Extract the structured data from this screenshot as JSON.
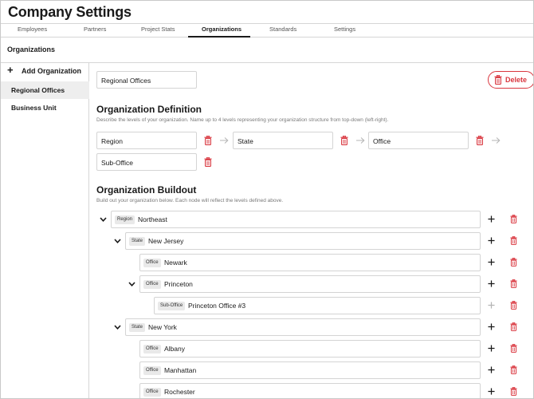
{
  "app": {
    "title": "Company Settings"
  },
  "tabs": [
    {
      "label": "Employees",
      "active": false
    },
    {
      "label": "Partners",
      "active": false
    },
    {
      "label": "Project Stats",
      "active": false
    },
    {
      "label": "Organizations",
      "active": true
    },
    {
      "label": "Standards",
      "active": false
    },
    {
      "label": "Settings",
      "active": false
    }
  ],
  "section": {
    "title": "Organizations"
  },
  "sidebar": {
    "add_label": "Add Organization",
    "items": [
      {
        "label": "Regional Offices",
        "selected": true
      },
      {
        "label": "Business Unit",
        "selected": false
      }
    ]
  },
  "org": {
    "name_value": "Regional Offices",
    "delete_label": "Delete"
  },
  "definition": {
    "title": "Organization Definition",
    "description": "Describe the levels of your organization. Name up to 4 levels representing your organization structure from top-down (left-right).",
    "levels": [
      "Region",
      "State",
      "Office",
      "Sub-Office"
    ]
  },
  "buildout": {
    "title": "Organization Buildout",
    "description": "Build out your organization below. Each node will reflect the levels defined above.",
    "nodes": [
      {
        "level": "Region",
        "name": "Northeast",
        "depth": 0,
        "expanded": true,
        "can_add": true
      },
      {
        "level": "State",
        "name": "New Jersey",
        "depth": 1,
        "expanded": true,
        "can_add": true
      },
      {
        "level": "Office",
        "name": "Newark",
        "depth": 2,
        "expanded": null,
        "can_add": true
      },
      {
        "level": "Office",
        "name": "Princeton",
        "depth": 2,
        "expanded": true,
        "can_add": true
      },
      {
        "level": "Sub-Office",
        "name": "Princeton Office #3",
        "depth": 3,
        "expanded": null,
        "can_add": false
      },
      {
        "level": "State",
        "name": "New York",
        "depth": 1,
        "expanded": true,
        "can_add": true
      },
      {
        "level": "Office",
        "name": "Albany",
        "depth": 2,
        "expanded": null,
        "can_add": true
      },
      {
        "level": "Office",
        "name": "Manhattan",
        "depth": 2,
        "expanded": null,
        "can_add": true
      },
      {
        "level": "Office",
        "name": "Rochester",
        "depth": 2,
        "expanded": null,
        "can_add": true
      }
    ]
  },
  "colors": {
    "danger": "#d9363e",
    "muted_icon": "#b5b5b5",
    "text": "#1a1a1a"
  }
}
